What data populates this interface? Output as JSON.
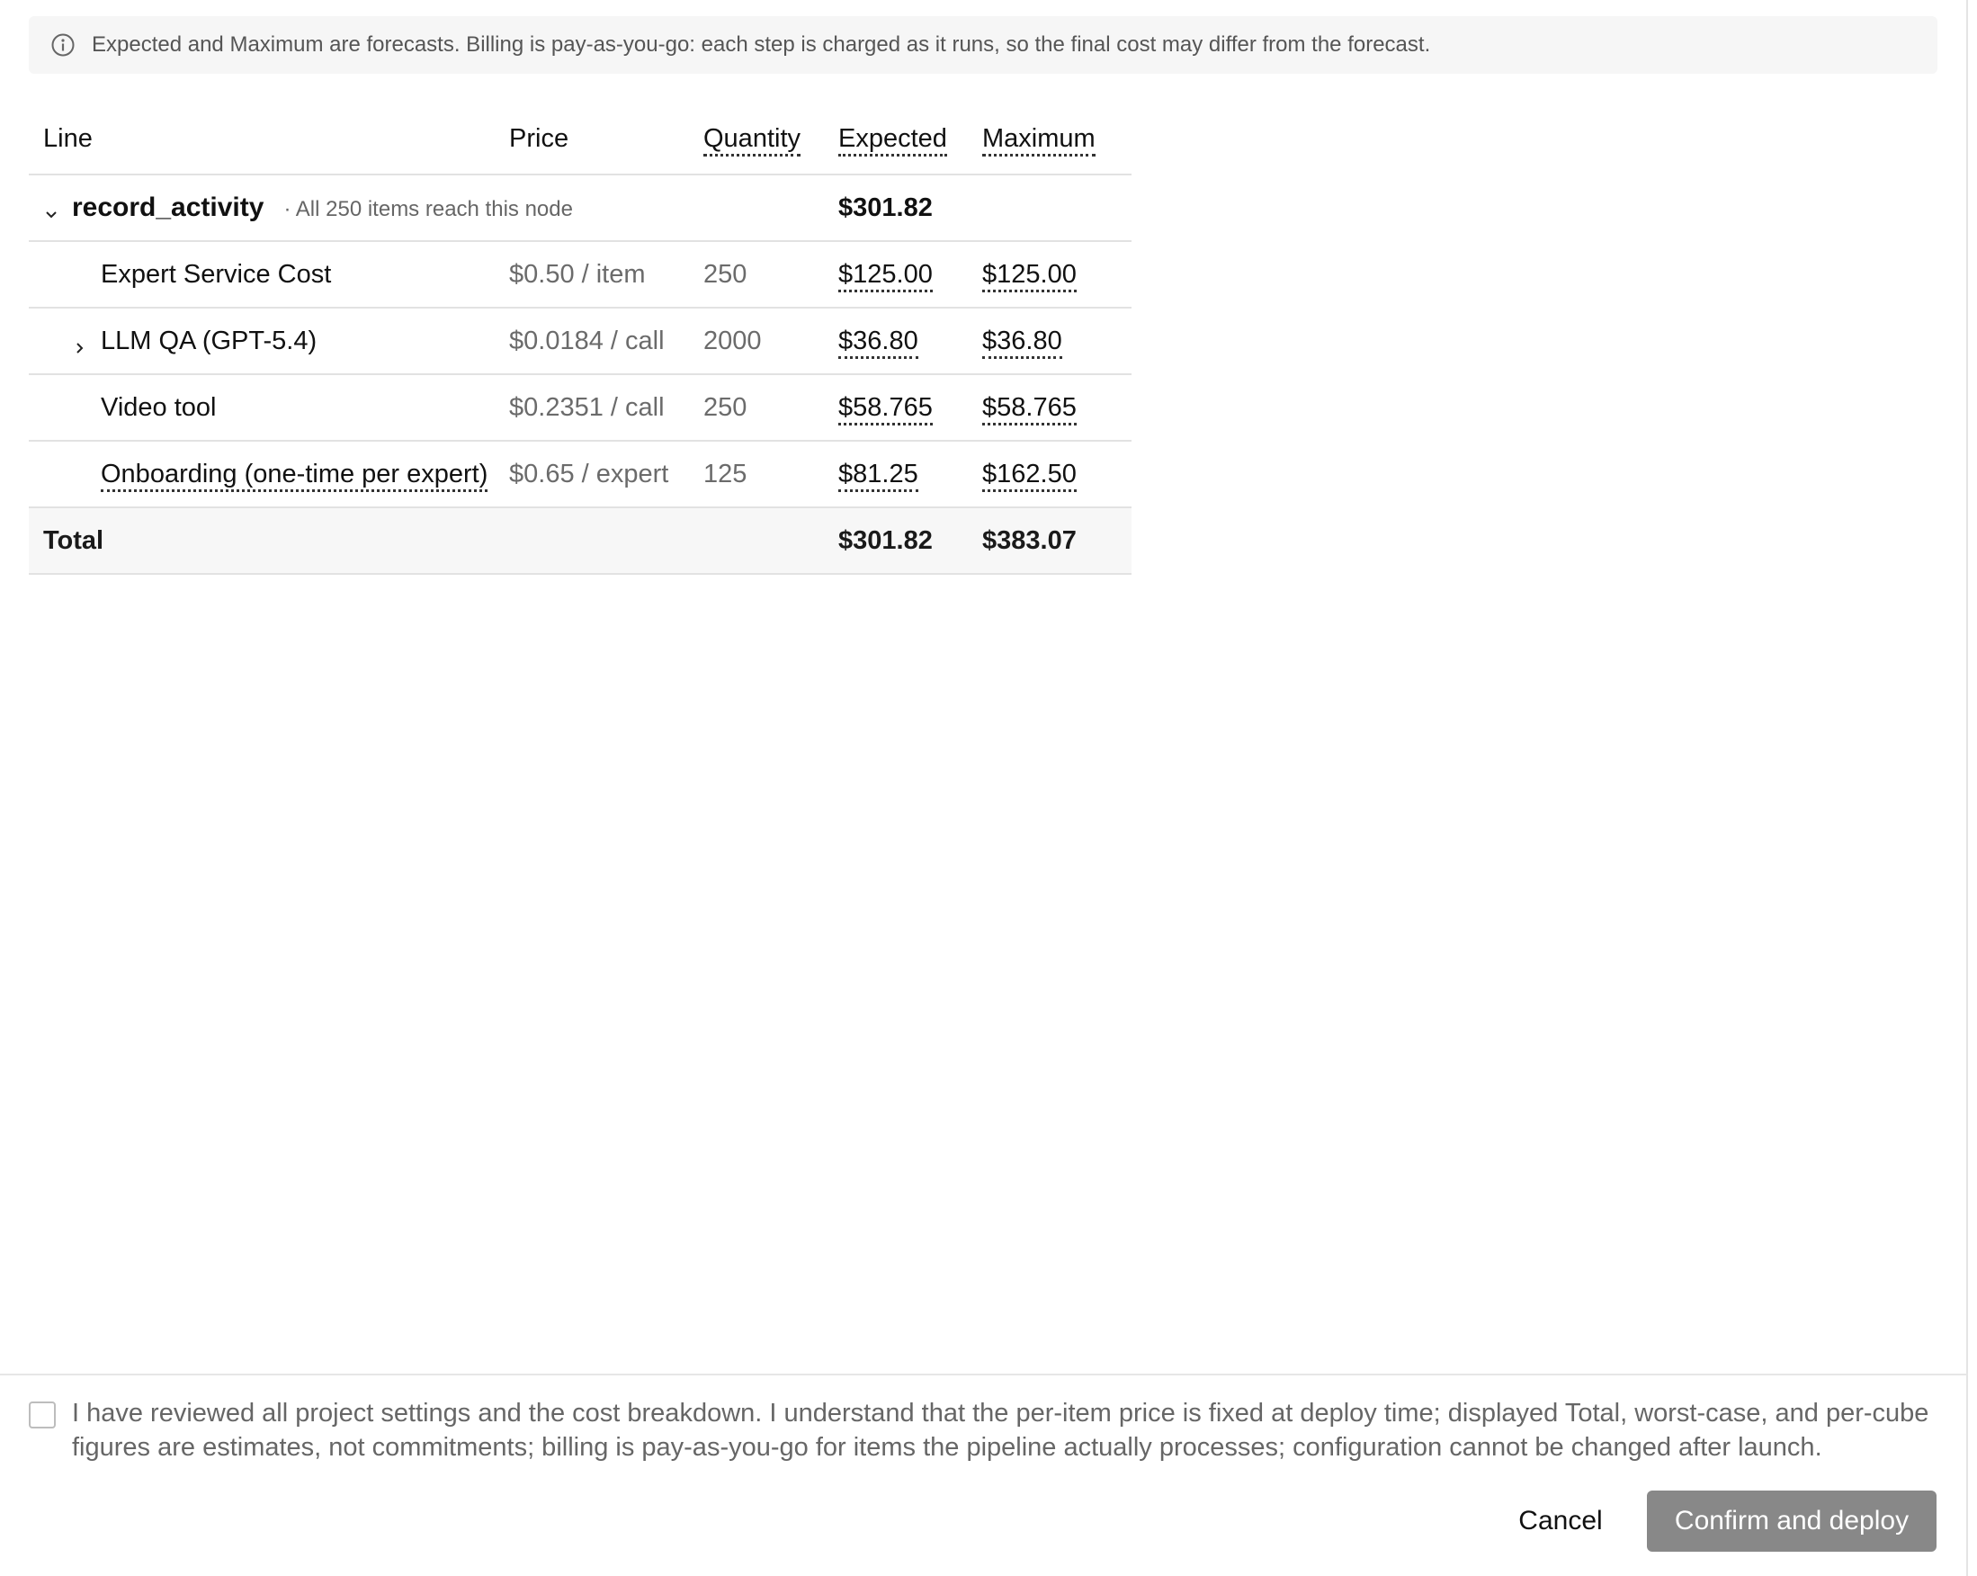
{
  "banner": {
    "icon": "info-icon",
    "text": "Expected and Maximum are forecasts. Billing is pay-as-you-go: each step is charged as it runs, so the final cost may differ from the forecast."
  },
  "table": {
    "headers": {
      "line": "Line",
      "price": "Price",
      "quantity": "Quantity",
      "expected": "Expected",
      "maximum": "Maximum"
    },
    "group": {
      "name": "record_activity",
      "note": "· All 250 items reach this node",
      "expected": "$301.82",
      "expanded": true
    },
    "rows": [
      {
        "line": "Expert Service Cost",
        "price": "$0.50 / item",
        "quantity": "250",
        "expected": "$125.00",
        "maximum": "$125.00"
      },
      {
        "line": "LLM QA (GPT-5.4)",
        "price": "$0.0184 / call",
        "quantity": "2000",
        "expected": "$36.80",
        "maximum": "$36.80",
        "expandable": true
      },
      {
        "line": "Video tool",
        "price": "$0.2351 / call",
        "quantity": "250",
        "expected": "$58.765",
        "maximum": "$58.765"
      },
      {
        "line": "Onboarding (one-time per expert)",
        "price": "$0.65 / expert",
        "quantity": "125",
        "expected": "$81.25",
        "maximum": "$162.50"
      }
    ],
    "total": {
      "label": "Total",
      "expected": "$301.82",
      "maximum": "$383.07"
    }
  },
  "acknowledgement": {
    "checked": false,
    "text": "I have reviewed all project settings and the cost breakdown. I understand that the per-item price is fixed at deploy time; displayed Total, worst-case, and per-cube figures are estimates, not commitments; billing is pay-as-you-go for items the pipeline actually processes; configuration cannot be changed after launch."
  },
  "actions": {
    "cancel_label": "Cancel",
    "confirm_label": "Confirm and deploy"
  },
  "colors": {
    "confirm_button_disabled": "#888888",
    "banner_background": "#f6f6f6",
    "total_row_background": "#f7f7f7"
  }
}
